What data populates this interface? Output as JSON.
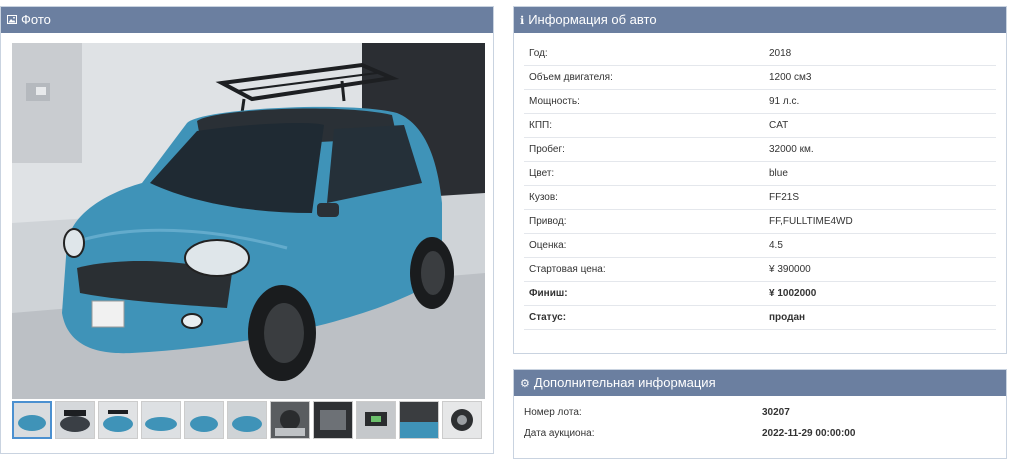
{
  "photo_panel": {
    "icon": "image-icon",
    "title": "Фото"
  },
  "info_panel": {
    "icon": "info-icon",
    "title": "Информация об авто",
    "rows": [
      {
        "label": "Год:",
        "value": "2018"
      },
      {
        "label": "Объем двигателя:",
        "value": "1200 см3"
      },
      {
        "label": "Мощность:",
        "value": "91 л.с."
      },
      {
        "label": "КПП:",
        "value": "CAT"
      },
      {
        "label": "Пробег:",
        "value": "32000 км."
      },
      {
        "label": "Цвет:",
        "value": "blue"
      },
      {
        "label": "Кузов:",
        "value": "FF21S"
      },
      {
        "label": "Привод:",
        "value": "FF,FULLTIME4WD"
      },
      {
        "label": "Оценка:",
        "value": "4.5"
      },
      {
        "label": "Стартовая цена:",
        "value": "¥ 390000"
      },
      {
        "label": "Финиш:",
        "value": "¥ 1002000"
      },
      {
        "label": "Статус:",
        "value": "продан"
      }
    ]
  },
  "extra_panel": {
    "icon": "cogs-icon",
    "title": "Дополнительная информация",
    "rows": [
      {
        "label": "Номер лота:",
        "value": "30207"
      },
      {
        "label": "Дата аукциона:",
        "value": "2022-11-29 00:00:00"
      }
    ]
  },
  "colors": {
    "panel_header": "#6b7fa0",
    "car_body": "#3f93b8",
    "thumb_active": "#4b90d0"
  }
}
